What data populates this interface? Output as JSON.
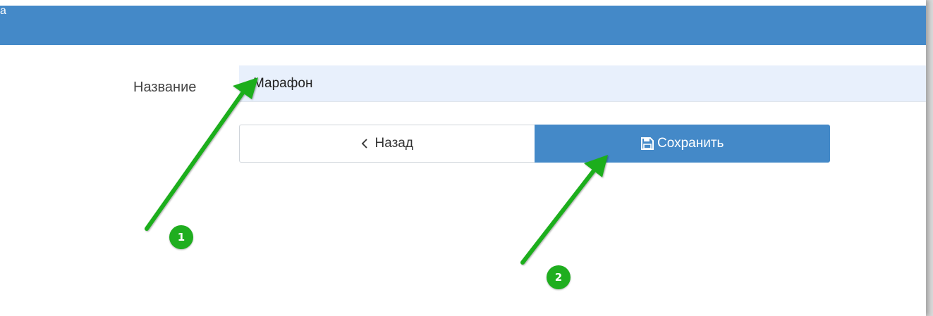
{
  "window": {
    "title": "a"
  },
  "form": {
    "name_label": "Название",
    "name_value": "Марафон"
  },
  "buttons": {
    "back_label": "Назад",
    "save_label": "Сохранить",
    "back_icon": "chevron-left-icon",
    "save_icon": "floppy-disk-icon"
  },
  "annotations": {
    "step_1": "1",
    "step_2": "2",
    "color": "#1fae1f"
  },
  "colors": {
    "header": "#4489c8",
    "primary_button": "#4489c8",
    "input_background": "#e8f0fc"
  }
}
